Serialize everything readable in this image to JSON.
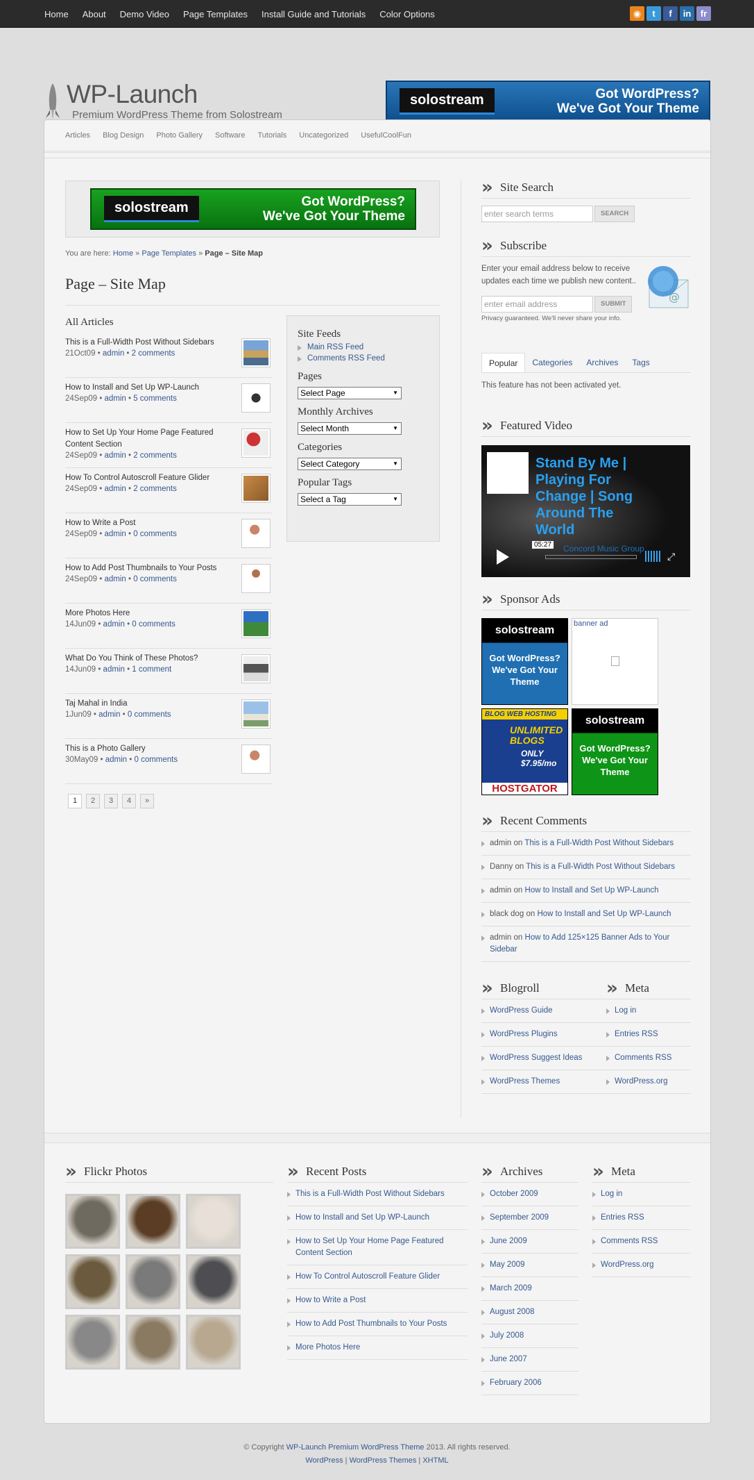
{
  "topnav": [
    "Home",
    "About",
    "Demo Video",
    "Page Templates",
    "Install Guide and Tutorials",
    "Color Options"
  ],
  "social": [
    {
      "name": "rss-icon",
      "glyph": "◉",
      "color": "#e9851b"
    },
    {
      "name": "twitter-icon",
      "glyph": "t",
      "color": "#3a9ad9"
    },
    {
      "name": "facebook-icon",
      "glyph": "f",
      "color": "#3a5a99"
    },
    {
      "name": "linkedin-icon",
      "glyph": "in",
      "color": "#2a6fa8"
    },
    {
      "name": "flickr-icon",
      "glyph": "fr",
      "color": "#8d8dcc"
    }
  ],
  "header": {
    "title": "WP-Launch",
    "tagline": "Premium WordPress Theme from Solostream",
    "banner_brand": "solostream",
    "banner_line1": "Got WordPress?",
    "banner_line2": "We've Got Your Theme"
  },
  "catnav": [
    "Articles",
    "Blog Design",
    "Photo Gallery",
    "Software",
    "Tutorials",
    "Uncategorized",
    "UsefulCoolFun"
  ],
  "ad": {
    "brand": "solostream",
    "line1": "Got WordPress?",
    "line2": "We've Got Your Theme"
  },
  "breadcrumb": {
    "prefix": "You are here:",
    "home": "Home",
    "sep": "»",
    "templates": "Page Templates",
    "current": "Page – Site Map"
  },
  "page_title": "Page – Site Map",
  "all_articles": "All Articles",
  "articles": [
    {
      "title": "This is a Full-Width Post Without Sidebars",
      "date": "21Oct09",
      "author": "admin",
      "comments": "2 comments",
      "thumb": "linear-gradient(#7aa3d6 0 40%,#c9a25b 40% 70%,#4a6c8e 70%)"
    },
    {
      "title": "How to Install and Set Up WP-Launch",
      "date": "24Sep09",
      "author": "admin",
      "comments": "5 comments",
      "thumb": "radial-gradient(circle,#333 0 25%,#fff 26%)"
    },
    {
      "title": "How to Set Up Your Home Page Featured Content Section",
      "date": "24Sep09",
      "author": "admin",
      "comments": "2 comments",
      "thumb": "radial-gradient(circle at 40% 35%,#c33 0 30%,#eee 32%)"
    },
    {
      "title": "How To Control Autoscroll Feature Glider",
      "date": "24Sep09",
      "author": "admin",
      "comments": "2 comments",
      "thumb": "linear-gradient(135deg,#c88a45,#8b5a2b)"
    },
    {
      "title": "How to Write a Post",
      "date": "24Sep09",
      "author": "admin",
      "comments": "0 comments",
      "thumb": "radial-gradient(circle at 45% 35%,#c9856a 0 22%,#fff 24%)"
    },
    {
      "title": "How to Add Post Thumbnails to Your Posts",
      "date": "24Sep09",
      "author": "admin",
      "comments": "0 comments",
      "thumb": "radial-gradient(circle at 50% 30%,#b07050 0 18%,#fff 20%)"
    },
    {
      "title": "More Photos Here",
      "date": "14Jun09",
      "author": "admin",
      "comments": "0 comments",
      "thumb": "linear-gradient(#2f6fc1 0 45%,#3f8a3a 45%)"
    },
    {
      "title": "What Do You Think of These Photos?",
      "date": "14Jun09",
      "author": "admin",
      "comments": "1 comment",
      "thumb": "linear-gradient(#eee 0 30%,#555 30% 65%,#ddd 65%)"
    },
    {
      "title": "Taj Mahal in India",
      "date": "1Jun09",
      "author": "admin",
      "comments": "0 comments",
      "thumb": "linear-gradient(#9bc1e8 0 50%,#e8e4d8 50% 75%,#7a9e6a 75%)"
    },
    {
      "title": "This is a Photo Gallery",
      "date": "30May09",
      "author": "admin",
      "comments": "0 comments",
      "thumb": "radial-gradient(circle at 45% 35%,#c9856a 0 22%,#fff 24%)"
    }
  ],
  "pager": [
    "1",
    "2",
    "3",
    "4",
    "»"
  ],
  "sitemap": {
    "feeds_title": "Site Feeds",
    "feeds": [
      "Main RSS Feed",
      "Comments RSS Feed"
    ],
    "pages_title": "Pages",
    "pages_sel": "Select Page",
    "monthly_title": "Monthly Archives",
    "monthly_sel": "Select Month",
    "cat_title": "Categories",
    "cat_sel": "Select Category",
    "tags_title": "Popular Tags",
    "tags_sel": "Select a Tag"
  },
  "search": {
    "title": "Site Search",
    "placeholder": "enter search terms",
    "button": "SEARCH"
  },
  "subscribe": {
    "title": "Subscribe",
    "text": "Enter your email address below to receive updates each time we publish new content..",
    "placeholder": "enter email address",
    "button": "SUBMIT",
    "privacy": "Privacy guaranteed. We'll never share your info."
  },
  "tabs": {
    "items": [
      "Popular",
      "Categories",
      "Archives",
      "Tags"
    ],
    "msg": "This feature has not been activated yet."
  },
  "video": {
    "title": "Featured Video",
    "caption": "Stand By Me | Playing For Change | Song Around The World",
    "time": "05:27",
    "channel": "Concord Music Group"
  },
  "sponsor": {
    "title": "Sponsor Ads",
    "brand": "solostream",
    "ad_text": "Got WordPress? We've Got Your Theme",
    "banner_alt": "banner ad",
    "hg_top": "BLOG WEB HOSTING",
    "hg_mid": "UNLIMITED BLOGS",
    "hg_price": "ONLY $7.95/mo",
    "hg_brand": "HOSTGATOR"
  },
  "recent_comments": {
    "title": "Recent Comments",
    "items": [
      {
        "who": "admin",
        "on": "on",
        "post": "This is a Full-Width Post Without Sidebars"
      },
      {
        "who": "Danny",
        "on": "on",
        "post": "This is a Full-Width Post Without Sidebars"
      },
      {
        "who": "admin",
        "on": "on",
        "post": "How to Install and Set Up WP-Launch"
      },
      {
        "who": "black dog",
        "on": "on",
        "post": "How to Install and Set Up WP-Launch"
      },
      {
        "who": "admin",
        "on": "on",
        "post": "How to Add 125×125 Banner Ads to Your Sidebar"
      }
    ]
  },
  "blogroll": {
    "title": "Blogroll",
    "items": [
      "WordPress Guide",
      "WordPress Plugins",
      "WordPress Suggest Ideas",
      "WordPress Themes"
    ]
  },
  "meta": {
    "title": "Meta",
    "items": [
      "Log in",
      "Entries RSS",
      "Comments RSS",
      "WordPress.org"
    ]
  },
  "footer": {
    "flickr_title": "Flickr Photos",
    "flickr": [
      "#6e6a60",
      "#5a3d24",
      "#e8e0d8",
      "#6b5a3e",
      "#7a7a7a",
      "#4e4e52",
      "#888",
      "#8a7a62",
      "#b8a890"
    ],
    "recent_title": "Recent Posts",
    "recent": [
      "This is a Full-Width Post Without Sidebars",
      "How to Install and Set Up WP-Launch",
      "How to Set Up Your Home Page Featured Content Section",
      "How To Control Autoscroll Feature Glider",
      "How to Write a Post",
      "How to Add Post Thumbnails to Your Posts",
      "More Photos Here"
    ],
    "archives_title": "Archives",
    "archives": [
      "October 2009",
      "September 2009",
      "June 2009",
      "May 2009",
      "March 2009",
      "August 2008",
      "July 2008",
      "June 2007",
      "February 2006"
    ],
    "meta_title": "Meta",
    "meta": [
      "Log in",
      "Entries RSS",
      "Comments RSS",
      "WordPress.org"
    ]
  },
  "copyright": {
    "pre": "© Copyright",
    "link": "WP-Launch Premium WordPress Theme",
    "post": "2013. All rights reserved.",
    "links": [
      "WordPress",
      "WordPress Themes",
      "XHTML"
    ]
  }
}
